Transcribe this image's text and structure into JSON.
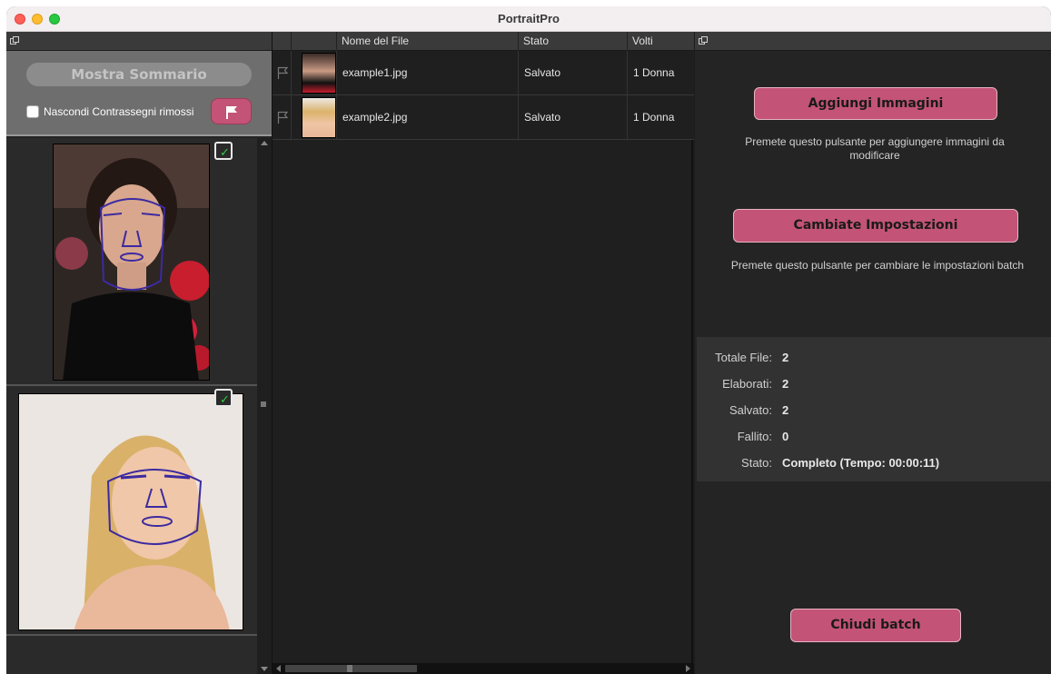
{
  "window": {
    "title": "PortraitPro"
  },
  "left_panel": {
    "summary_button": "Mostra Sommario",
    "hide_checkbox_label": "Nascondi Contrassegni rimossi"
  },
  "table": {
    "columns": [
      "Nome del File",
      "Stato",
      "Volti"
    ],
    "rows": [
      {
        "file": "example1.jpg",
        "status": "Salvato",
        "faces": "1 Donna"
      },
      {
        "file": "example2.jpg",
        "status": "Salvato",
        "faces": "1 Donna"
      }
    ]
  },
  "right_panel": {
    "add_images_button": "Aggiungi Immagini",
    "add_images_hint": "Premete questo pulsante per aggiungere immagini da modificare",
    "change_settings_button": "Cambiate Impostazioni",
    "change_settings_hint": "Premete questo pulsante per cambiare le impostazioni batch",
    "close_batch_button": "Chiudi batch",
    "stats": [
      {
        "label": "Totale File:",
        "value": "2"
      },
      {
        "label": "Elaborati:",
        "value": "2"
      },
      {
        "label": "Salvato:",
        "value": "2"
      },
      {
        "label": "Fallito:",
        "value": "0"
      },
      {
        "label": "Stato:",
        "value": "Completo (Tempo: 00:00:11)"
      }
    ]
  },
  "colors": {
    "accent_pink": "#c35377",
    "saved_check": "#2ecc40",
    "panel_dark": "#242424"
  },
  "icons": {
    "undock": "undock-icon",
    "flag": "flag-icon",
    "save_check": "save-check-icon"
  }
}
